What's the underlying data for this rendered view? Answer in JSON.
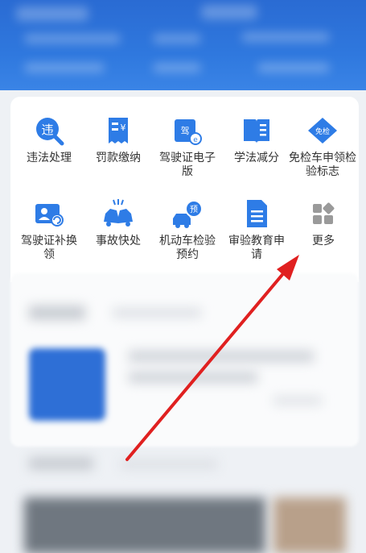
{
  "colors": {
    "accent": "#2e7ce6",
    "arrow": "#e02020"
  },
  "services": [
    {
      "label": "违法处理",
      "icon": "violation-search-icon",
      "glyph": "违"
    },
    {
      "label": "罚款缴纳",
      "icon": "fine-receipt-icon",
      "glyph": "¥"
    },
    {
      "label": "驾驶证电子版",
      "icon": "e-license-icon",
      "glyph": "驾"
    },
    {
      "label": "学法减分",
      "icon": "open-book-icon",
      "glyph": ""
    },
    {
      "label": "免检车申领检验标志",
      "icon": "inspection-exempt-icon",
      "glyph": "免检"
    },
    {
      "label": "驾驶证补换领",
      "icon": "license-renew-icon",
      "glyph": ""
    },
    {
      "label": "事故快处",
      "icon": "car-accident-icon",
      "glyph": ""
    },
    {
      "label": "机动车检验预约",
      "icon": "vehicle-appointment-icon",
      "glyph": "预"
    },
    {
      "label": "审验教育申请",
      "icon": "document-icon",
      "glyph": ""
    },
    {
      "label": "更多",
      "icon": "more-grid-icon",
      "glyph": ""
    }
  ]
}
